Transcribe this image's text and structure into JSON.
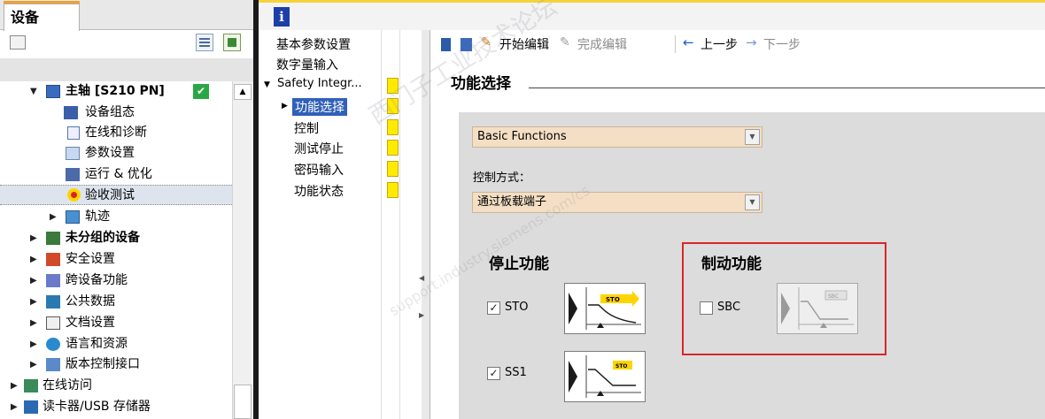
{
  "left_panel": {
    "tab_label": "设备",
    "tree": [
      {
        "label": "主轴 [S210 PN]",
        "bold": true,
        "status": "✔"
      },
      {
        "label": "设备组态"
      },
      {
        "label": "在线和诊断"
      },
      {
        "label": "参数设置"
      },
      {
        "label": "运行 & 优化"
      },
      {
        "label": "验收测试"
      },
      {
        "label": "轨迹"
      },
      {
        "label": "未分组的设备",
        "bold": true
      },
      {
        "label": "安全设置"
      },
      {
        "label": "跨设备功能"
      },
      {
        "label": "公共数据"
      },
      {
        "label": "文档设置"
      },
      {
        "label": "语言和资源"
      },
      {
        "label": "版本控制接口"
      },
      {
        "label": "在线访问"
      },
      {
        "label": "读卡器/USB 存储器"
      }
    ]
  },
  "info_button": "i",
  "nav": {
    "items": [
      "基本参数设置",
      "数字量输入",
      "Safety Integr...",
      "功能选择",
      "控制",
      "测试停止",
      "密码输入",
      "功能状态"
    ]
  },
  "toolbar": {
    "start_edit": "开始编辑",
    "finish_edit": "完成编辑",
    "prev": "上一步",
    "next": "下一步"
  },
  "form": {
    "title": "功能选择",
    "functions_value": "Basic Functions",
    "control_mode_label": "控制方式：",
    "control_mode_value": "通过板载端子",
    "stop_section": "停止功能",
    "brake_section": "制动功能",
    "sto_label": "STO",
    "ss1_label": "SS1",
    "sbc_label": "SBC",
    "img_sto": "STO",
    "img_ss1": "STO",
    "img_sbc": "SBC"
  },
  "watermark": {
    "text1": "西门子工业技术论坛",
    "text2": "support.industry.siemens.com/cs"
  },
  "colors": {
    "accent_yellow": "#ffeb00",
    "highlight_box": "#d9252a",
    "info_blue": "#1b3fa8"
  }
}
